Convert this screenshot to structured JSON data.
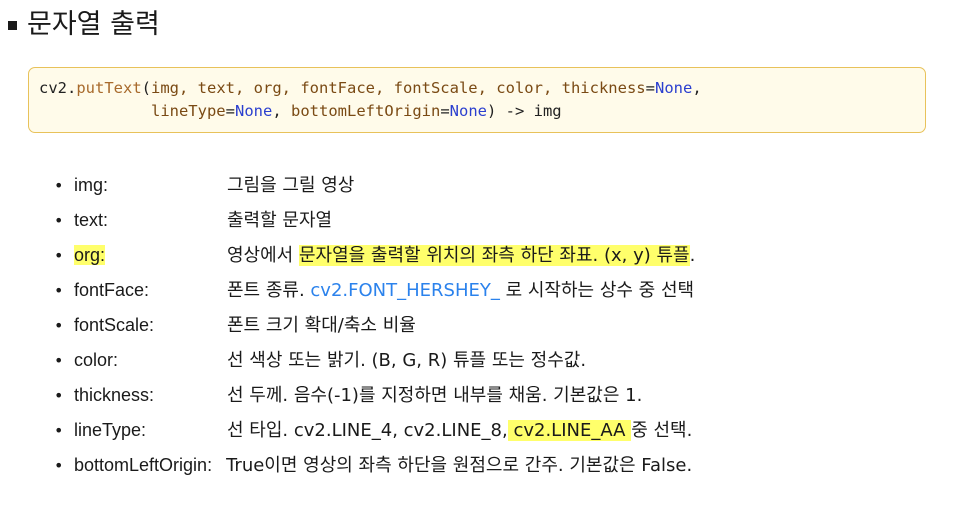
{
  "title": "문자열 출력",
  "code": {
    "module": "cv2",
    "dot": ".",
    "function": "putText",
    "open_paren": "(",
    "args_positional": "img, text, org, fontFace, fontScale, color,",
    "kw1_name": "thickness",
    "kw2_name": "lineType",
    "kw3_name": "bottomLeftOrigin",
    "eq": "=",
    "none_value": "None",
    "comma": ",",
    "close_return": ") -> img"
  },
  "params": [
    {
      "name": "img:",
      "desc": "그림을 그릴 영상"
    },
    {
      "name": "text:",
      "desc": "출력할 문자열"
    },
    {
      "name": "org:",
      "desc_hl": "문자열을 출력할 위치의 좌측 하단 좌표. (x, y) 튜플",
      "desc_pre": "영상에서 ",
      "desc_post": "."
    },
    {
      "name": "fontFace:",
      "desc_pre": "폰트 종류. ",
      "desc_blue": "cv2.FONT_HERSHEY_",
      "desc_post": " 로 시작하는 상수 중 선택"
    },
    {
      "name": "fontScale:",
      "desc": "폰트 크기 확대/축소 비율"
    },
    {
      "name": "color:",
      "desc": "선 색상 또는 밝기. (B, G, R) 튜플 또는 정수값."
    },
    {
      "name": "thickness:",
      "desc": "선 두께. 음수(-1)를 지정하면 내부를 채움. 기본값은 1."
    },
    {
      "name": "lineType:",
      "desc_pre": "선 타입. cv2.LINE_4, cv2.LINE_8,",
      "desc_hl": " cv2.LINE_AA ",
      "desc_post": "중 선택."
    },
    {
      "name": "bottomLeftOrigin:",
      "desc": "True이면 영상의 좌측 하단을 원점으로 간주. 기본값은 False."
    }
  ],
  "bullet_char": "•"
}
